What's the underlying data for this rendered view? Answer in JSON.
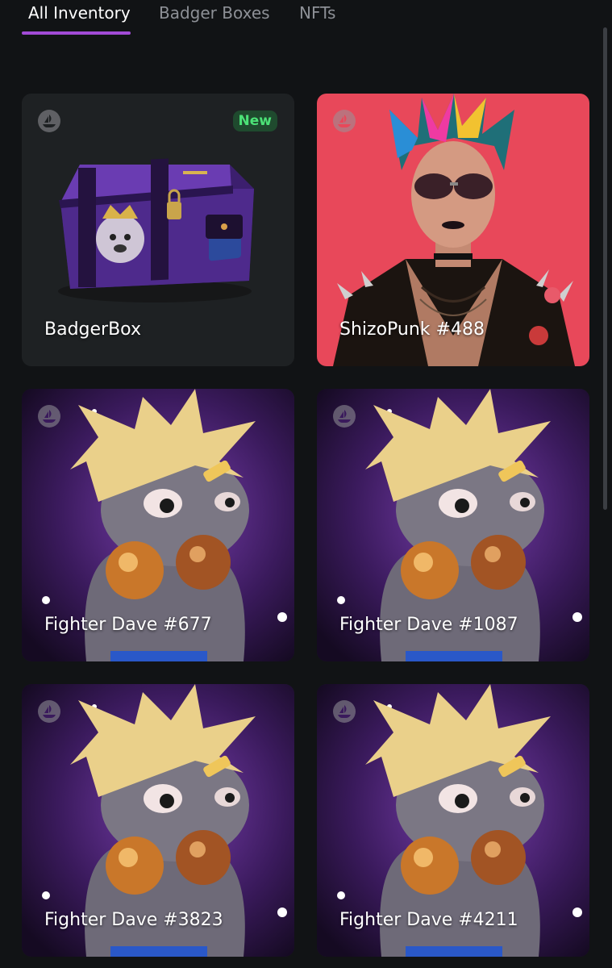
{
  "tabs": [
    {
      "label": "All Inventory",
      "active": true
    },
    {
      "label": "Badger Boxes",
      "active": false
    },
    {
      "label": "NFTs",
      "active": false
    }
  ],
  "colors": {
    "accent": "#a24bd6",
    "background": "#111315",
    "card": "#1e2123",
    "new_badge_text": "#4ce277",
    "punk_background": "#e8485a",
    "fighter_background": "#3a1a5c"
  },
  "items": [
    {
      "name": "BadgerBox",
      "badge": "New",
      "chain_icon": "opensea-sailboat-icon",
      "art": "purple-loot-box"
    },
    {
      "name": "ShizoPunk #488",
      "chain_icon": "opensea-sailboat-icon",
      "art": "punk-portrait"
    },
    {
      "name": "Fighter Dave #677",
      "chain_icon": "opensea-sailboat-icon",
      "art": "badger-boxer"
    },
    {
      "name": "Fighter Dave #1087",
      "chain_icon": "opensea-sailboat-icon",
      "art": "badger-boxer"
    },
    {
      "name": "Fighter Dave #3823",
      "chain_icon": "opensea-sailboat-icon",
      "art": "badger-boxer"
    },
    {
      "name": "Fighter Dave #4211",
      "chain_icon": "opensea-sailboat-icon",
      "art": "badger-boxer"
    }
  ]
}
